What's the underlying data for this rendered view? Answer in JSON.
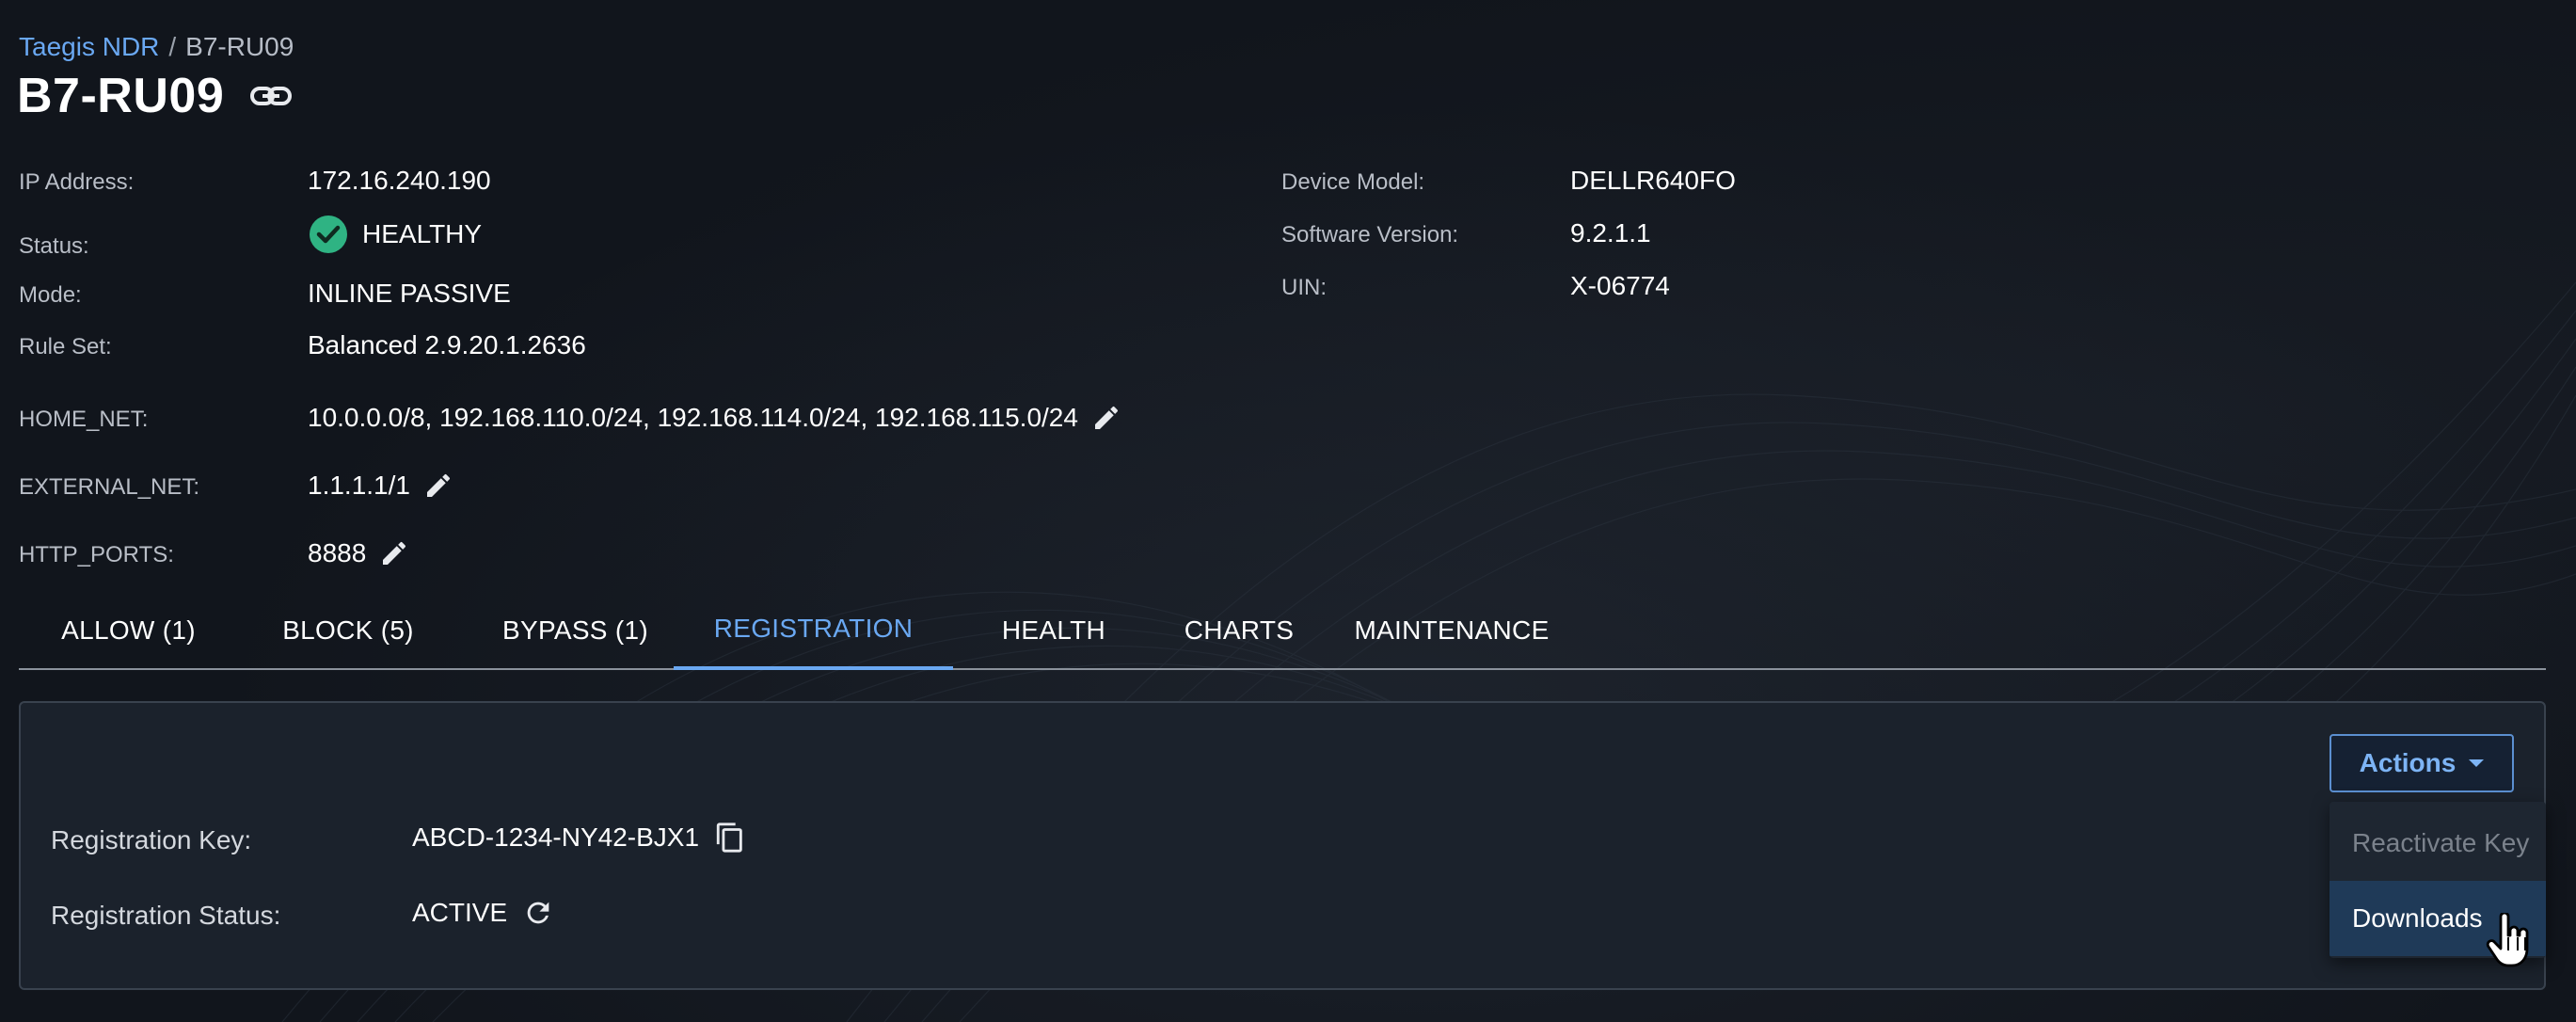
{
  "breadcrumb": {
    "root": "Taegis NDR",
    "separator": "/",
    "current": "B7-RU09"
  },
  "title": "B7-RU09",
  "details_left": {
    "ip_label": "IP Address:",
    "ip_value": "172.16.240.190",
    "status_label": "Status:",
    "status_value": "HEALTHY",
    "mode_label": "Mode:",
    "mode_value": "INLINE PASSIVE",
    "ruleset_label": "Rule Set:",
    "ruleset_value": "Balanced 2.9.20.1.2636",
    "home_net_label": "HOME_NET:",
    "home_net_value": "10.0.0.0/8, 192.168.110.0/24, 192.168.114.0/24, 192.168.115.0/24",
    "external_net_label": "EXTERNAL_NET:",
    "external_net_value": "1.1.1.1/1",
    "http_ports_label": "HTTP_PORTS:",
    "http_ports_value": "8888"
  },
  "details_right": {
    "model_label": "Device Model:",
    "model_value": "DELLR640FO",
    "software_label": "Software Version:",
    "software_value": "9.2.1.1",
    "uin_label": "UIN:",
    "uin_value": "X-06774"
  },
  "tabs": [
    {
      "label": "ALLOW (1)"
    },
    {
      "label": "BLOCK (5)"
    },
    {
      "label": "BYPASS (1)"
    },
    {
      "label": "REGISTRATION",
      "active": true
    },
    {
      "label": "HEALTH"
    },
    {
      "label": "CHARTS"
    },
    {
      "label": "MAINTENANCE"
    }
  ],
  "registration": {
    "key_label": "Registration Key:",
    "key_value": "ABCD-1234-NY42-BJX1",
    "status_label": "Registration Status:",
    "status_value": "ACTIVE"
  },
  "actions": {
    "button_label": "Actions",
    "menu": [
      {
        "label": "Reactivate Key",
        "disabled": true
      },
      {
        "label": "Downloads",
        "hovered": true
      }
    ]
  },
  "colors": {
    "accent": "#6aa8f2",
    "healthy": "#2fb383",
    "background": "#11151c",
    "panel": "#1b222c"
  },
  "icons": [
    "link-icon",
    "check-circle-icon",
    "pencil-icon",
    "copy-icon",
    "refresh-icon",
    "caret-down-icon",
    "hand-cursor-icon"
  ]
}
